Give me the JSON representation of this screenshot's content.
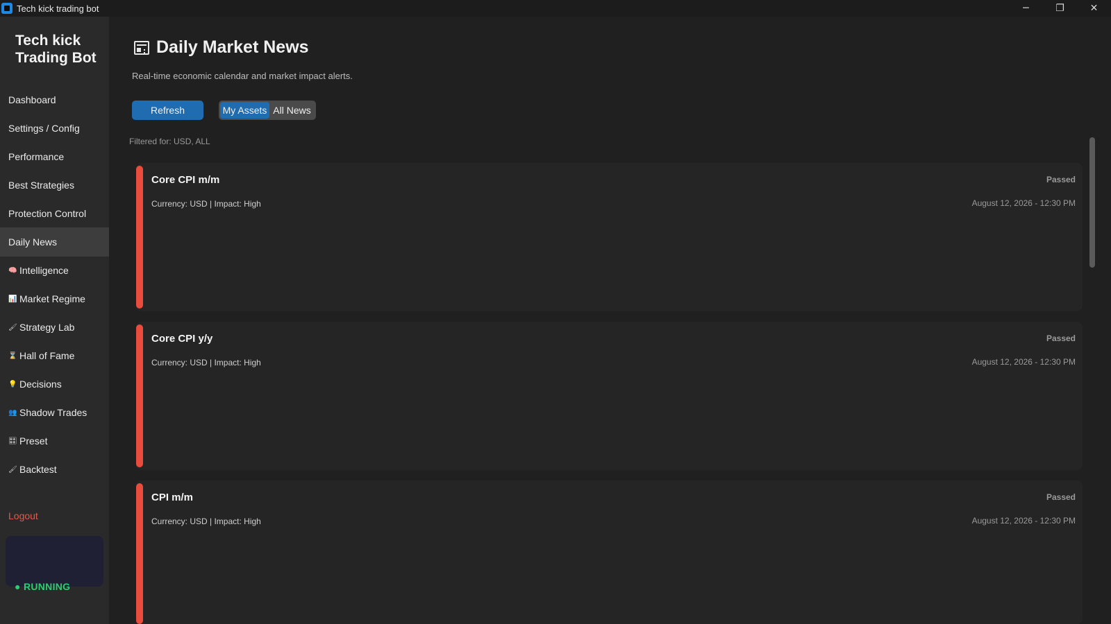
{
  "window": {
    "title": "Tech kick trading bot",
    "controls": {
      "minimize": "─",
      "maximize": "❐",
      "close": "✕"
    }
  },
  "sidebar": {
    "brand": "Tech kick Trading Bot",
    "items": [
      {
        "label": "Dashboard",
        "icon": ""
      },
      {
        "label": "Settings / Config",
        "icon": ""
      },
      {
        "label": "Performance",
        "icon": ""
      },
      {
        "label": "Best Strategies",
        "icon": ""
      },
      {
        "label": "Protection Control",
        "icon": ""
      },
      {
        "label": "Daily News",
        "icon": "",
        "active": true
      },
      {
        "label": "Intelligence",
        "icon": "🧠"
      },
      {
        "label": "Market Regime",
        "icon": "📊"
      },
      {
        "label": "Strategy Lab",
        "icon": "🖌"
      },
      {
        "label": "Hall of Fame",
        "icon": "⌛"
      },
      {
        "label": "Decisions",
        "icon": "💡"
      },
      {
        "label": "Shadow Trades",
        "icon": "👥"
      },
      {
        "label": "Preset",
        "icon": "🎛"
      },
      {
        "label": "Backtest",
        "icon": "🖌"
      }
    ],
    "logout": "Logout",
    "status": "● RUNNING"
  },
  "main": {
    "title": "Daily Market News",
    "subtitle": "Real-time economic calendar and market impact alerts.",
    "refresh_label": "Refresh",
    "toggle": {
      "my_assets": "My Assets",
      "all_news": "All News"
    },
    "filter_text": "Filtered for: USD, ALL",
    "news": [
      {
        "title": "Core CPI m/m",
        "meta": "Currency: USD | Impact: High",
        "status": "Passed",
        "date": "August 12, 2026 - 12:30 PM"
      },
      {
        "title": "Core CPI y/y",
        "meta": "Currency: USD | Impact: High",
        "status": "Passed",
        "date": "August 12, 2026 - 12:30 PM"
      },
      {
        "title": "CPI m/m",
        "meta": "Currency: USD | Impact: High",
        "status": "Passed",
        "date": "August 12, 2026 - 12:30 PM"
      }
    ]
  },
  "colors": {
    "accent": "#1f6cb0",
    "impact_high": "#e74c3c",
    "running": "#2ecc71",
    "logout": "#e05a4e"
  }
}
